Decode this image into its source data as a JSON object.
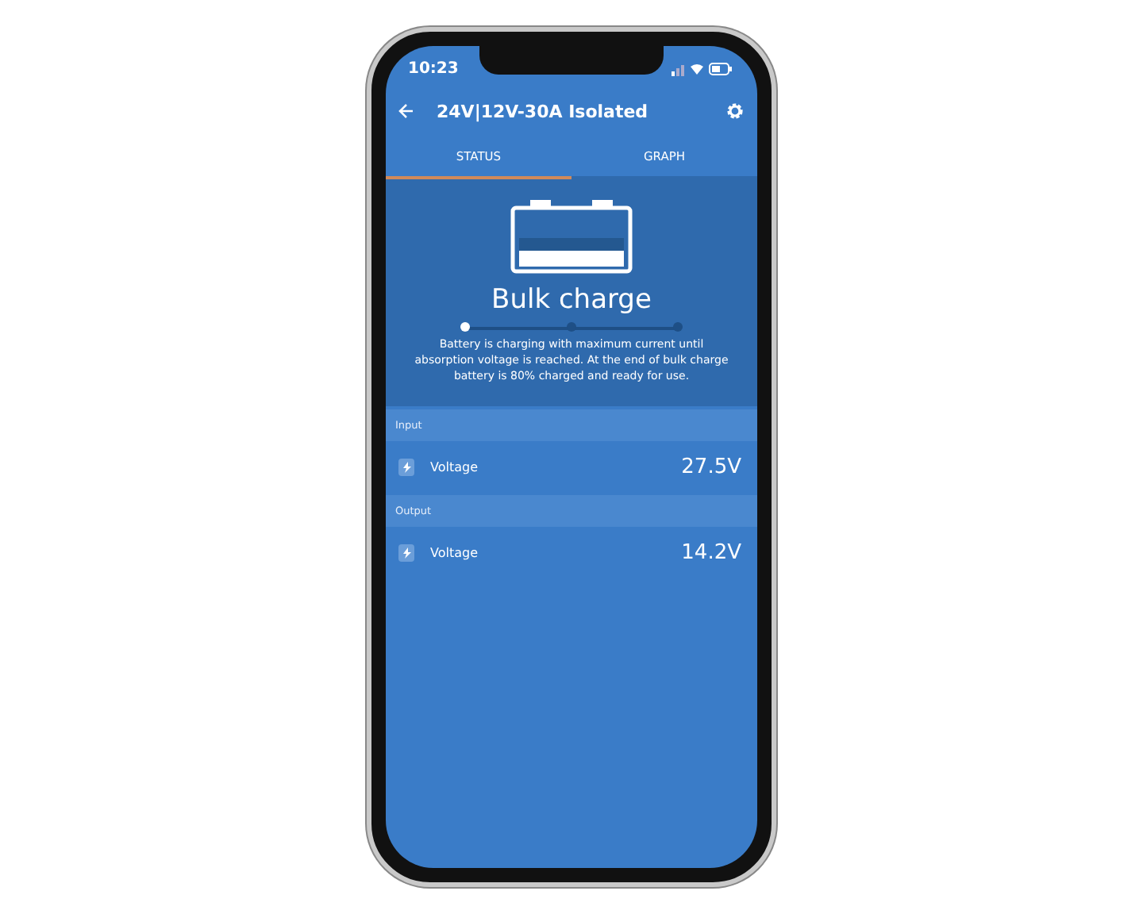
{
  "status_bar": {
    "time": "10:23"
  },
  "header": {
    "title": "24V|12V-30A Isolated"
  },
  "tabs": [
    {
      "label": "STATUS",
      "selected": true
    },
    {
      "label": "GRAPH",
      "selected": false
    }
  ],
  "charge": {
    "state": "Bulk charge",
    "steps": [
      {
        "selected": true
      },
      {
        "selected": false
      },
      {
        "selected": false
      }
    ],
    "description": "Battery is charging with maximum current until absorption voltage is reached. At the end of bulk charge battery is  80% charged and ready for use."
  },
  "sections": [
    {
      "title": "Input",
      "rows": [
        {
          "label": "Voltage",
          "value": "27.5V"
        }
      ]
    },
    {
      "title": "Output",
      "rows": [
        {
          "label": "Voltage",
          "value": "14.2V"
        }
      ]
    }
  ]
}
